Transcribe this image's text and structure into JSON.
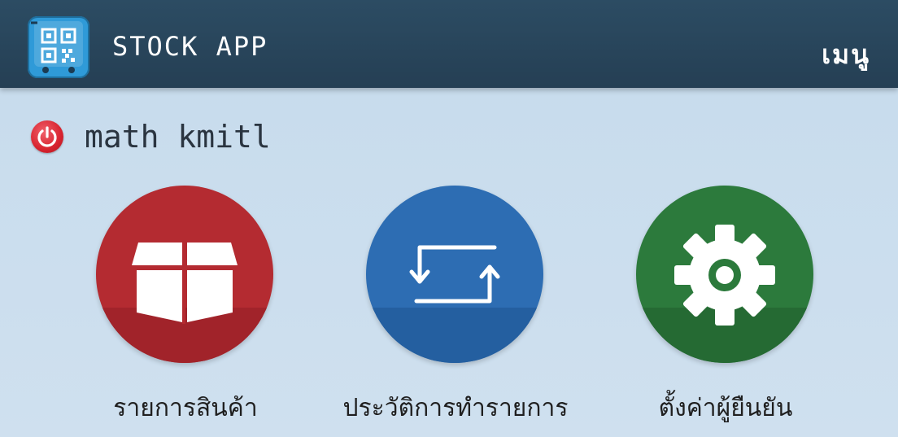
{
  "header": {
    "app_title": "STOCK APP",
    "menu_label": "เมนู",
    "app_icon": "qr-code-icon"
  },
  "user": {
    "name": "math kmitl",
    "logout_icon": "power-icon"
  },
  "menu": [
    {
      "id": "products",
      "label": "รายการสินค้า",
      "icon": "box-icon",
      "color": "#b42b31"
    },
    {
      "id": "history",
      "label": "ประวัติการทำรายการ",
      "icon": "transfer-icon",
      "color": "#2d6db3"
    },
    {
      "id": "settings",
      "label": "ตั้งค่าผู้ยืนยัน",
      "icon": "gear-icon",
      "color": "#2c7a3c"
    }
  ],
  "colors": {
    "header_bg": "#2c4c63",
    "page_bg": "#c6dbec",
    "power_red": "#d8232f"
  }
}
